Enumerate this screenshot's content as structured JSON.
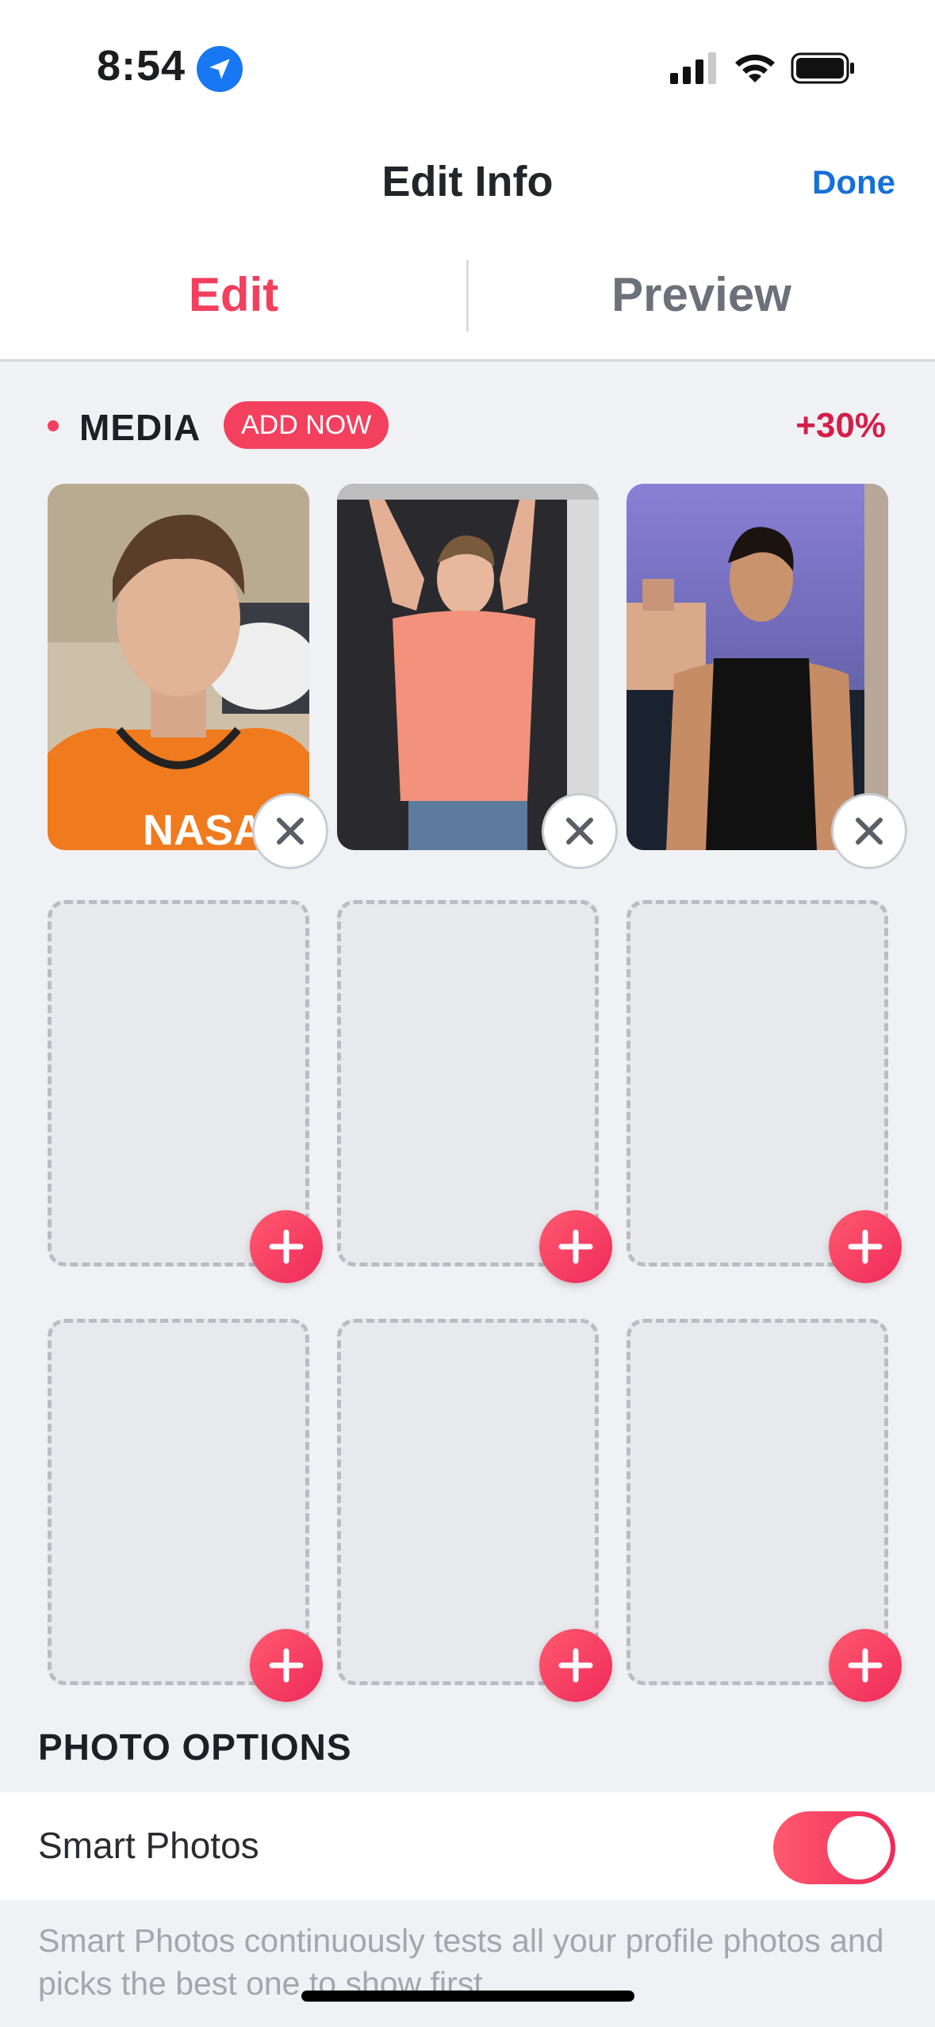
{
  "status_bar": {
    "time": "8:54"
  },
  "nav": {
    "title": "Edit Info",
    "done_label": "Done"
  },
  "tabs": [
    {
      "label": "Edit",
      "active": true
    },
    {
      "label": "Preview",
      "active": false
    }
  ],
  "media": {
    "label": "MEDIA",
    "add_now_label": "ADD NOW",
    "boost": "+30%",
    "photos": [
      {
        "description": "man-orange-tank-top",
        "removable": true
      },
      {
        "description": "man-pink-tshirt-arms-raised",
        "removable": true
      },
      {
        "description": "man-black-tank-balcony",
        "removable": true
      }
    ],
    "empty_slots": 6
  },
  "photo_options": {
    "heading": "PHOTO OPTIONS",
    "smart_photos_label": "Smart Photos",
    "smart_photos_enabled": true,
    "description": "Smart Photos continuously tests all your profile photos and picks the best one to show first."
  },
  "colors": {
    "accent": "#f2405e",
    "link_blue": "#1670d6",
    "background": "#f0f1f4"
  }
}
